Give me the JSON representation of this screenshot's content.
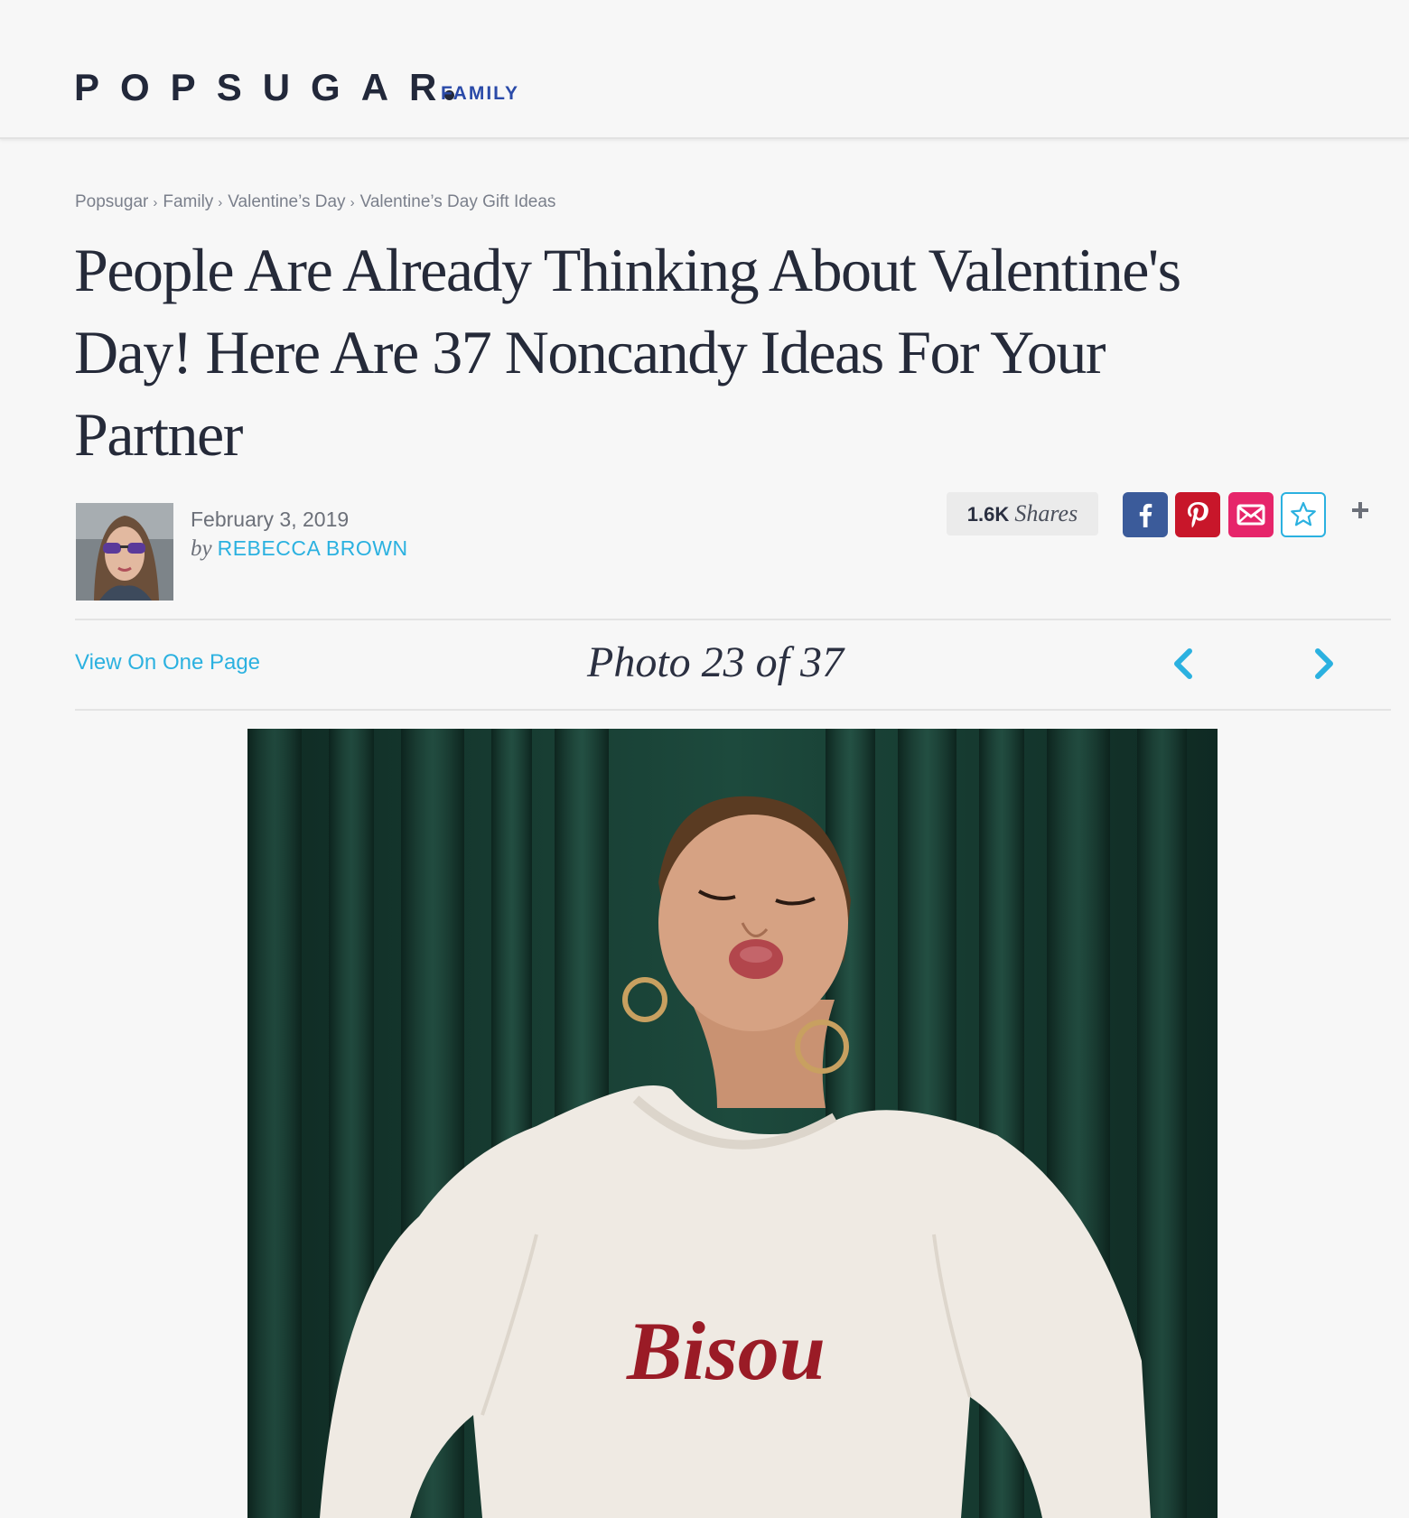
{
  "header": {
    "logo_text": "POPSUGAR",
    "section": "FAMILY"
  },
  "breadcrumb": [
    {
      "label": "Popsugar"
    },
    {
      "label": "Family"
    },
    {
      "label": "Valentine’s Day"
    },
    {
      "label": "Valentine’s Day Gift Ideas"
    }
  ],
  "article": {
    "title": "People Are Already Thinking About Valentine's Day! Here Are 37 Noncandy Ideas For Your Partner",
    "date": "February 3, 2019",
    "by_label": "by",
    "author": "REBECCA BROWN"
  },
  "share": {
    "count": "1.6K",
    "label": "Shares",
    "buttons": [
      "facebook-icon",
      "pinterest-icon",
      "email-icon",
      "star-icon",
      "plus-icon"
    ],
    "colors": {
      "facebook": "#3b5b9a",
      "pinterest": "#c8162a",
      "email": "#e6256a",
      "accent": "#2bb1e0"
    }
  },
  "gallery": {
    "view_all": "View On One Page",
    "counter": "Photo 23 of 37",
    "photo_text": "Bisou"
  }
}
